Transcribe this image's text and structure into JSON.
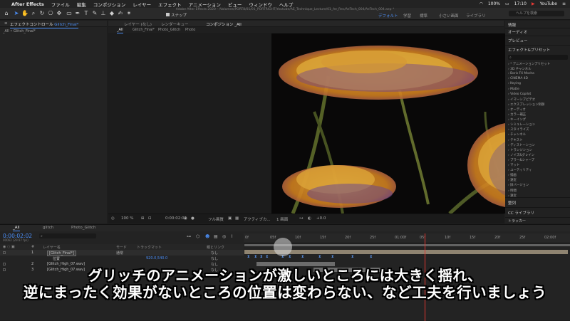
{
  "menubar": {
    "apple": "",
    "app": "After Effects",
    "items": [
      "ファイル",
      "編集",
      "コンポジション",
      "レイヤー",
      "エフェクト",
      "アニメーション",
      "ビュー",
      "ウィンドウ",
      "ヘルプ"
    ],
    "right": {
      "battery": "100%",
      "time": "17:10",
      "app_badge": "YouTube"
    }
  },
  "window_title": "Adobe After Effects 2020 - /Volumes/PORT8/01/01_PORTRIGHT/Youtube/AE_Technique_Lecture/01_Ae_Rec/AeTech_004/AeTech_004.aep *",
  "toolbar": {
    "snap_label": "スナップ",
    "workspaces": [
      "デフォルト",
      "学習",
      "標準",
      "小さい画面",
      "ライブラリ"
    ],
    "active_workspace": "デフォルト",
    "help_search_placeholder": "ヘルプを検索"
  },
  "left_panel": {
    "tab": "エフェクトコントロール",
    "tab_layer": "Glitch_Final*",
    "breadcrumb": "_All • Glitch_Final*"
  },
  "comp_panel": {
    "tabs": [
      "レイヤー (なし)",
      "レンダーキュー",
      "コンポジション _All"
    ],
    "viewer_tabs": [
      "_All",
      "Glitch_Final*",
      "Photo_Glitch",
      "Photo"
    ],
    "bottom_bar": {
      "zoom": "100 %",
      "timecode": "0:00:02:02",
      "resolution": "フル画質",
      "camera": "アクティブカ...",
      "views": "1 画面",
      "offset": "+0.0"
    }
  },
  "right_panel": {
    "sections": [
      "情報",
      "オーディオ",
      "プレビュー",
      "エフェクト&プリセット"
    ],
    "effects": [
      "* アニメーションプリセット",
      "3D チャンネル",
      "Boris FX Mocha",
      "CINEMA 4D",
      "Keying",
      "Matte",
      "Video Copilot",
      "イマーシブビデオ",
      "エクスプレッション制御",
      "オーディオ",
      "カラー補正",
      "キーイング",
      "シミュレーション",
      "スタイライズ",
      "チャンネル",
      "テキスト",
      "ディストーション",
      "トランジション",
      "ノイズ&グレイン",
      "ブラー&シャープ",
      "マット",
      "ユーティリティ",
      "描画",
      "遠近",
      "旧バージョン",
      "時間",
      "遠近"
    ],
    "lower_sections": [
      "整列",
      "CC ライブラリ",
      "トラッカー"
    ]
  },
  "timeline": {
    "tabs": [
      "_All",
      "glitch",
      "Photo_Glitch"
    ],
    "timecode": "0:00:02:02",
    "timecode_sub": "00062 (29.97 fps)",
    "headers": {
      "layer_name": "レイヤー名",
      "mode": "モード",
      "trkmat": "トラックマット",
      "parent": "親とリンク"
    },
    "ruler_ticks": [
      "0f",
      "05f",
      "10f",
      "15f",
      "20f",
      "25f",
      "01:00f",
      "05f",
      "10f",
      "15f",
      "20f",
      "25f",
      "02:00f"
    ],
    "layers": [
      {
        "num": "1",
        "name": "[Glitch_Final*]",
        "mode": "通常",
        "parent": "なし"
      },
      {
        "num": "",
        "name": "位置",
        "value": "920.0,540.0",
        "parent": "なし"
      },
      {
        "num": "2",
        "name": "[Glitch_High_07.wav]",
        "mode": "",
        "parent": "なし"
      },
      {
        "num": "3",
        "name": "[Glitch_High_07.wav]",
        "mode": "",
        "parent": "なし"
      }
    ],
    "colors": {
      "layer1_bar": "#8f8471",
      "audio_bar": "#7a7a7a",
      "accent": "#4b8ef6",
      "playhead": "#e0352f"
    }
  },
  "subtitles": {
    "line1": "グリッチのアニメーションが激しいところには大きく揺れ、",
    "line2": "逆にまったく効果がないところの位置は変わらない、など工夫を行いましょう"
  }
}
